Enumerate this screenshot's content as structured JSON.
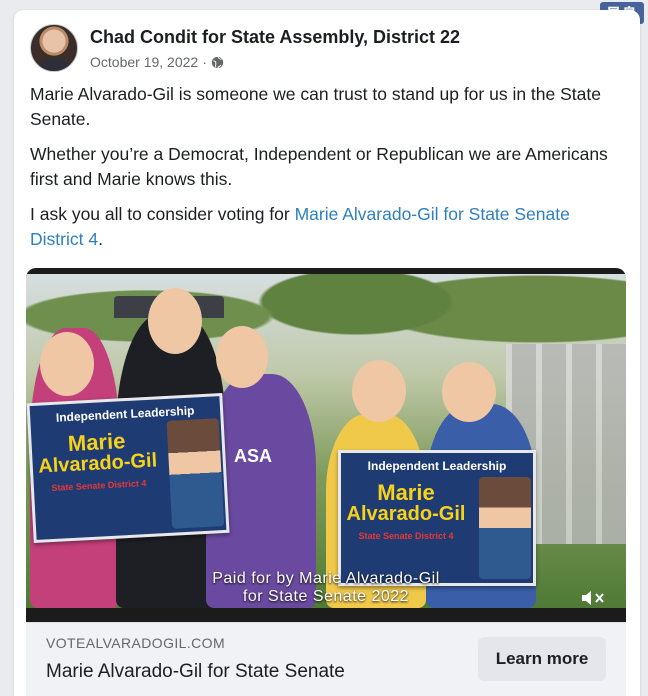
{
  "watermark": "星島",
  "post": {
    "author": "Chad Condit for State Assembly, District 22",
    "date": "October 19, 2022",
    "separator": "·",
    "paragraph1": "Marie Alvarado-Gil is someone we can trust to stand up for us in the State Senate.",
    "paragraph2": "Whether you’re a Democrat, Independent or Republican we are Americans first and Marie knows this.",
    "paragraph3_prefix": "I ask you all to consider voting for ",
    "paragraph3_link": "Marie Alvarado-Gil for State Senate District 4",
    "paragraph3_suffix": "."
  },
  "media": {
    "poster_left": {
      "headline": "Independent Leadership",
      "name_line1": "Marie",
      "name_line2": "Alvarado-Gil",
      "district": "State Senate District 4"
    },
    "poster_right": {
      "headline": "Independent Leadership",
      "name_line1": "Marie",
      "name_line2": "Alvarado-Gil",
      "district": "State Senate District 4"
    },
    "tshirt_text": "ASA",
    "caption_line1": "Paid for by Marie Alvarado-Gil",
    "caption_line2": "for State Senate 2022",
    "mute_icon": "muted-speaker-icon"
  },
  "link_preview": {
    "domain": "VOTEALVARADOGIL.COM",
    "title": "Marie Alvarado-Gil for State Senate",
    "cta_label": "Learn more"
  },
  "colors": {
    "link": "#2e7fbf",
    "poster_blue": "#1f3b73",
    "poster_yellow": "#f7d21a",
    "poster_red": "#e53935"
  }
}
